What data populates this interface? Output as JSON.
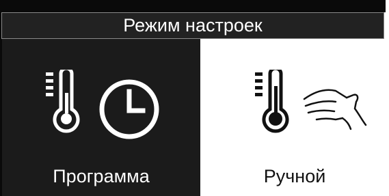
{
  "header": {
    "title": "Режим настроек"
  },
  "modes": [
    {
      "label": "Программа",
      "selected": true,
      "icons": [
        "thermometer-icon",
        "clock-icon"
      ]
    },
    {
      "label": "Ручной",
      "selected": false,
      "icons": [
        "thermometer-icon",
        "hand-icon"
      ]
    }
  ],
  "colors": {
    "selected_bg": "#1b1b1b",
    "header_bg": "#222222",
    "text_light": "#ffffff",
    "text_dark": "#111111"
  }
}
